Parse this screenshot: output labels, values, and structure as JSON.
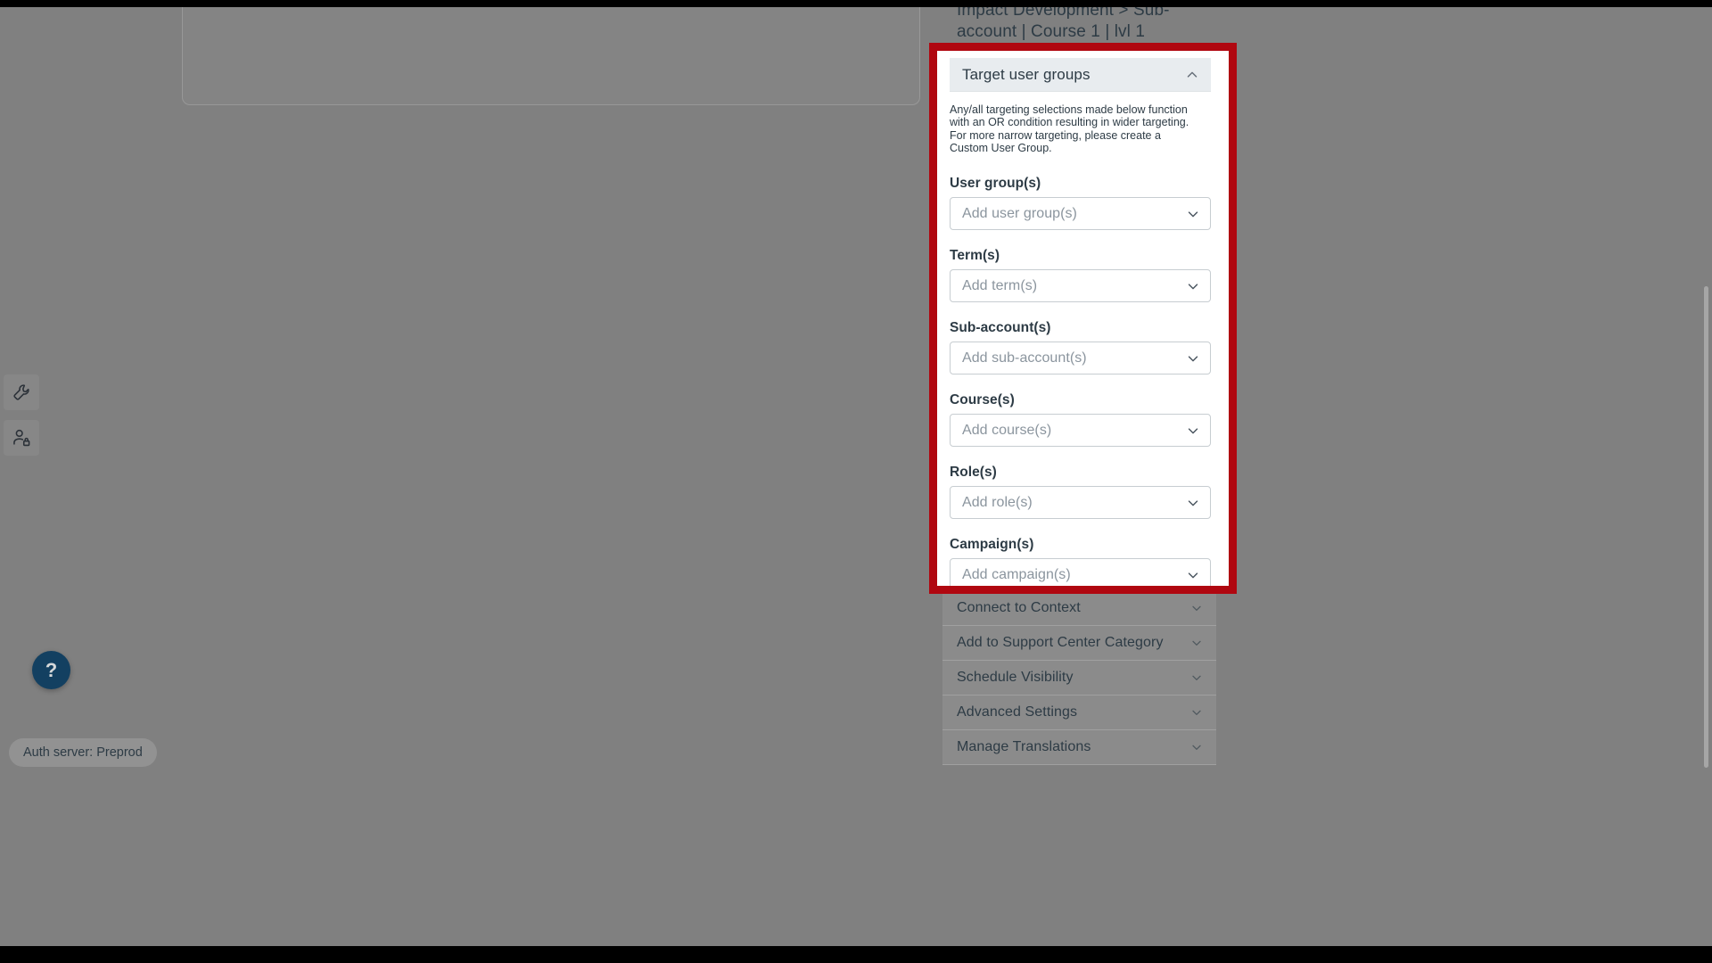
{
  "app": {
    "breadcrumb": "Impact Development > Sub-account | Course 1 | lvl 1",
    "auth_status": "Auth server: Preprod",
    "help_label": "?"
  },
  "colors": {
    "highlight_border": "#b00710",
    "panel_header_bg": "#e8ecef",
    "text_primary": "#2d3b45",
    "placeholder": "#8b959e",
    "help_fab": "#134061",
    "overlay_dim": "#808080"
  },
  "rail": {
    "items": [
      {
        "name": "tools-wrench",
        "icon": "wrench-icon"
      },
      {
        "name": "user-permissions",
        "icon": "user-lock-icon"
      }
    ]
  },
  "panel": {
    "title": "Target user groups",
    "collapse_icon": "chevron-up-icon",
    "expanded": true,
    "description": "Any/all targeting selections made below function with an OR condition resulting in wider targeting. For more narrow targeting, please create a Custom User Group.",
    "fields": [
      {
        "label": "User group(s)",
        "placeholder": "Add user group(s)",
        "value": "",
        "name": "user-groups"
      },
      {
        "label": "Term(s)",
        "placeholder": "Add term(s)",
        "value": "",
        "name": "terms"
      },
      {
        "label": "Sub-account(s)",
        "placeholder": "Add sub-account(s)",
        "value": "",
        "name": "sub-accounts"
      },
      {
        "label": "Course(s)",
        "placeholder": "Add course(s)",
        "value": "",
        "name": "courses"
      },
      {
        "label": "Role(s)",
        "placeholder": "Add role(s)",
        "value": "",
        "name": "roles"
      },
      {
        "label": "Campaign(s)",
        "placeholder": "Add campaign(s)",
        "value": "",
        "name": "campaigns"
      }
    ]
  },
  "accordion": {
    "sections": [
      {
        "label": "Connect to Context",
        "name": "connect-to-context",
        "expanded": false
      },
      {
        "label": "Add to Support Center Category",
        "name": "add-to-support-center-category",
        "expanded": false
      },
      {
        "label": "Schedule Visibility",
        "name": "schedule-visibility",
        "expanded": false
      },
      {
        "label": "Advanced Settings",
        "name": "advanced-settings",
        "expanded": false
      },
      {
        "label": "Manage Translations",
        "name": "manage-translations",
        "expanded": false
      }
    ]
  }
}
